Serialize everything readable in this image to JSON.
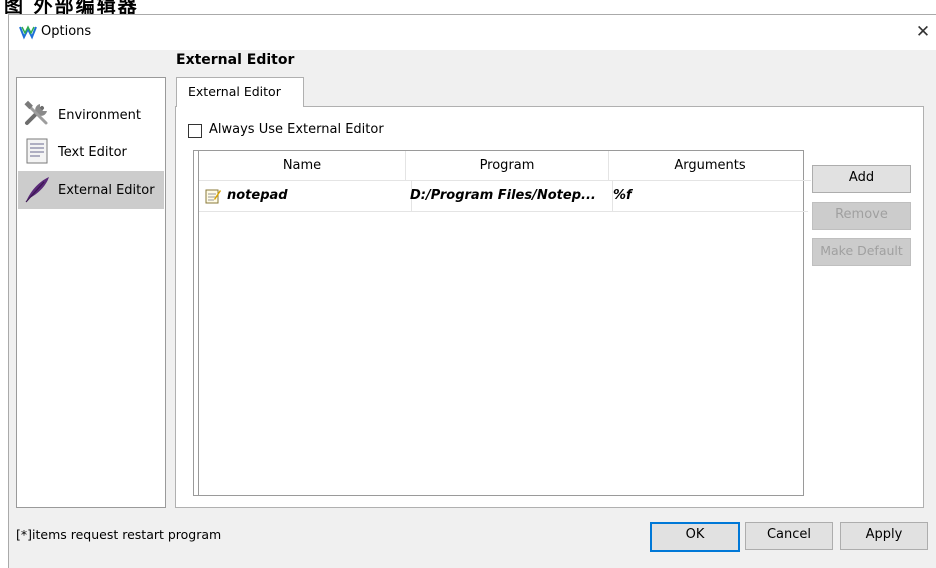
{
  "caption": {
    "text": "图     外部编辑器"
  },
  "window": {
    "title": "Options",
    "close_glyph": "✕"
  },
  "nav": {
    "items": [
      {
        "label": "Environment",
        "icon": "tools-icon",
        "selected": false
      },
      {
        "label": "Text Editor",
        "icon": "text-document-icon",
        "selected": false
      },
      {
        "label": "External Editor",
        "icon": "quill-feather-icon",
        "selected": true
      }
    ]
  },
  "section": {
    "title": "External Editor"
  },
  "tabs": [
    {
      "label": "External Editor",
      "active": true
    }
  ],
  "always_use": {
    "label": "Always Use External Editor",
    "checked": false
  },
  "table": {
    "columns": [
      "Name",
      "Program",
      "Arguments"
    ],
    "rows": [
      {
        "icon": "notepad-icon",
        "name": "notepad",
        "program": "D:/Program Files/Notep...",
        "arguments": "%f"
      }
    ]
  },
  "side_buttons": {
    "add": "Add",
    "remove": "Remove",
    "make_default": "Make Default"
  },
  "footer": {
    "note": "[*]items request restart program",
    "ok": "OK",
    "cancel": "Cancel",
    "apply": "Apply"
  },
  "colors": {
    "selection": "#cccccc",
    "default_button_border": "#0078d7",
    "dialog_bg": "#f0f0f0"
  }
}
